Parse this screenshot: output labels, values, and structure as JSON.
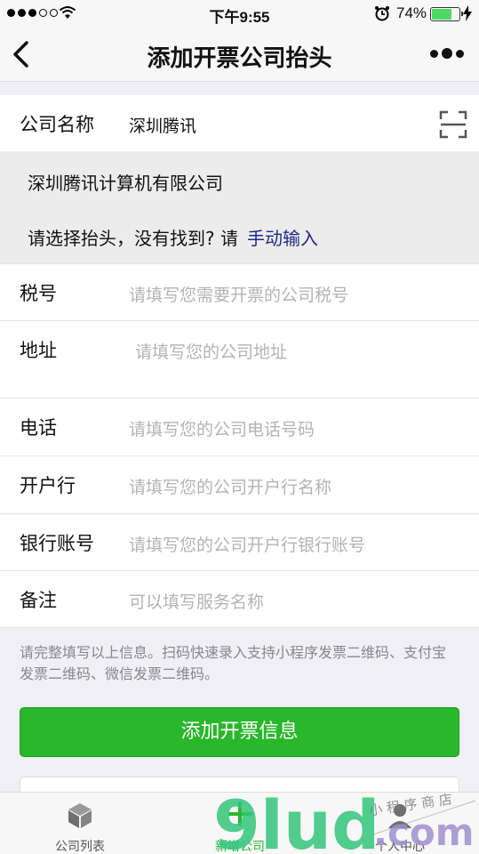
{
  "status_bar": {
    "time": "下午9:55",
    "battery_percent": "74%",
    "battery_level": 0.74,
    "signal_bars_filled": 3,
    "signal_bars_total": 5
  },
  "nav": {
    "title": "添加开票公司抬头",
    "back_icon": "chevron-left-icon",
    "more_icon": "more-dots-icon"
  },
  "company": {
    "label": "公司名称",
    "value": "深圳腾讯",
    "scan_icon": "scan-icon"
  },
  "suggestion": {
    "item": "深圳腾讯计算机有限公司",
    "hint": "请选择抬头，没有找到? 请",
    "manual_link": "手动输入"
  },
  "form": {
    "tax_id": {
      "label": "税号",
      "placeholder": "请填写您需要开票的公司税号"
    },
    "address": {
      "label": "地址",
      "placeholder": "请填写您的公司地址"
    },
    "phone": {
      "label": "电话",
      "placeholder": "请填写您的公司电话号码"
    },
    "bank": {
      "label": "开户行",
      "placeholder": "请填写您的公司开户行名称"
    },
    "account": {
      "label": "银行账号",
      "placeholder": "请填写您的公司开户行银行账号"
    },
    "remark": {
      "label": "备注",
      "placeholder": "可以填写服务名称"
    }
  },
  "note": "请完整填写以上信息。扫码快速录入支持小程序发票二维码、支付宝发票二维码、微信发票二维码。",
  "submit_label": "添加开票信息",
  "tabs": [
    {
      "label": "公司列表",
      "icon": "cube-icon"
    },
    {
      "label": "新增公司",
      "icon": "plus-icon"
    },
    {
      "label": "个人中心",
      "icon": "person-icon"
    }
  ],
  "watermark": {
    "brand": "9lud",
    "suffix": ".com",
    "tagline": "小 程 序 商 店"
  },
  "colors": {
    "accent_green": "#29b72b",
    "link_blue": "#1e2b86",
    "placeholder_gray": "#b3b3b3"
  }
}
